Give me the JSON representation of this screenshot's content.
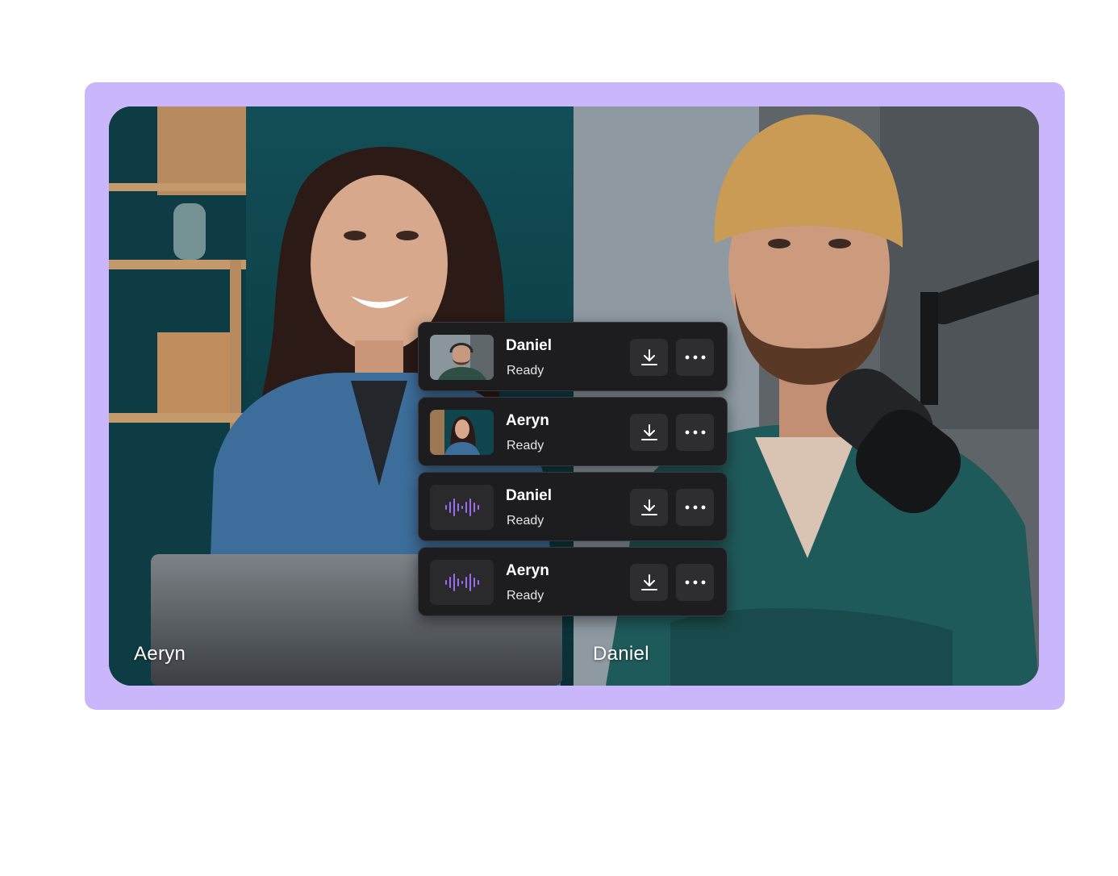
{
  "participants": {
    "left": {
      "name": "Aeryn"
    },
    "right": {
      "name": "Daniel"
    }
  },
  "tracks": [
    {
      "name": "Daniel",
      "status": "Ready",
      "kind": "video",
      "thumb_icon": "daniel-video-thumbnail"
    },
    {
      "name": "Aeryn",
      "status": "Ready",
      "kind": "video",
      "thumb_icon": "aeryn-video-thumbnail"
    },
    {
      "name": "Daniel",
      "status": "Ready",
      "kind": "audio",
      "thumb_icon": "audio-waveform-icon"
    },
    {
      "name": "Aeryn",
      "status": "Ready",
      "kind": "audio",
      "thumb_icon": "audio-waveform-icon"
    }
  ],
  "actions": {
    "download_icon": "download-icon",
    "more_icon": "more-options-icon"
  },
  "colors": {
    "frame": "#c9b6fb",
    "card": "#1d1d1f",
    "button": "#2e2e31",
    "waveform": "#9b6cf2"
  }
}
